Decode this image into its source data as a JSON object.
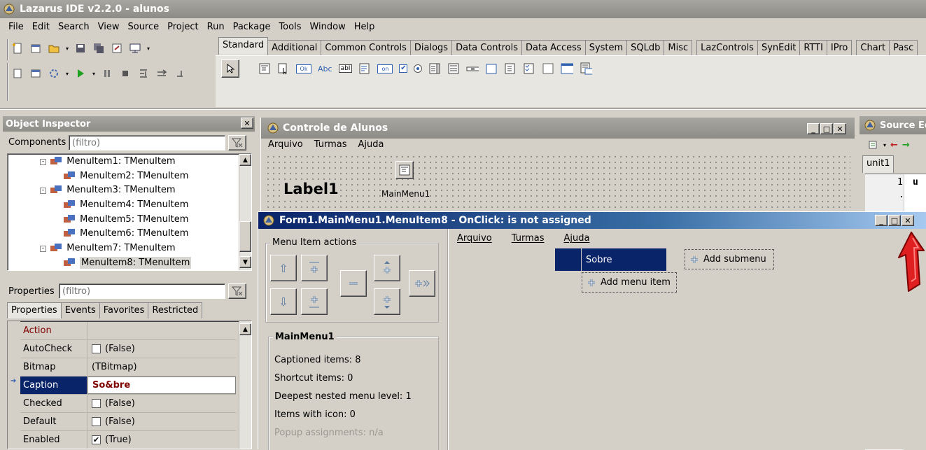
{
  "app": {
    "title": "Lazarus IDE v2.2.0 - alunos",
    "menu": [
      "File",
      "Edit",
      "Search",
      "View",
      "Source",
      "Project",
      "Run",
      "Package",
      "Tools",
      "Window",
      "Help"
    ]
  },
  "palette": {
    "tabs": [
      "Standard",
      "Additional",
      "Common Controls",
      "Dialogs",
      "Data Controls",
      "Data Access",
      "System",
      "SQLdb",
      "Misc",
      "LazControls",
      "SynEdit",
      "RTTI",
      "IPro",
      "Chart",
      "Pasc"
    ],
    "active_tab": "Standard",
    "component_labels": [
      "Ok",
      "Abc",
      "abI",
      "on"
    ]
  },
  "object_inspector": {
    "title": "Object Inspector",
    "components_label": "Components",
    "components_filter_placeholder": "(filtro)",
    "tree": [
      {
        "label": "MenuItem1: TMenuItem",
        "level": 1,
        "expander": "-"
      },
      {
        "label": "MenuItem2: TMenuItem",
        "level": 2
      },
      {
        "label": "MenuItem3: TMenuItem",
        "level": 1,
        "expander": "-"
      },
      {
        "label": "MenuItem4: TMenuItem",
        "level": 2
      },
      {
        "label": "MenuItem5: TMenuItem",
        "level": 2
      },
      {
        "label": "MenuItem6: TMenuItem",
        "level": 2
      },
      {
        "label": "MenuItem7: TMenuItem",
        "level": 1,
        "expander": "-"
      },
      {
        "label": "MenuItem8: TMenuItem",
        "level": 2,
        "selected": true
      }
    ],
    "properties_label": "Properties",
    "properties_filter_placeholder": "(filtro)",
    "tabs": [
      "Properties",
      "Events",
      "Favorites",
      "Restricted"
    ],
    "properties": [
      {
        "name": "Action",
        "value": "",
        "highlight_name": true
      },
      {
        "name": "AutoCheck",
        "value": "(False)",
        "checkbox": true,
        "checked": false
      },
      {
        "name": "Bitmap",
        "value": "(TBitmap)"
      },
      {
        "name": "Caption",
        "value": "So&bre",
        "selected": true
      },
      {
        "name": "Checked",
        "value": "(False)",
        "checkbox": true,
        "checked": false
      },
      {
        "name": "Default",
        "value": "(False)",
        "checkbox": true,
        "checked": false
      },
      {
        "name": "Enabled",
        "value": "(True)",
        "checkbox": true,
        "checked": true
      }
    ]
  },
  "form": {
    "title": "Controle de Alunos",
    "menu": [
      "Arquivo",
      "Turmas",
      "Ajuda"
    ],
    "label1": "Label1",
    "mainmenu_label": "MainMenu1"
  },
  "source_editor": {
    "title": "Source Ed",
    "tab": "unit1",
    "line_number": "1",
    "gutter_dot": ".",
    "code_char": "u"
  },
  "menu_editor": {
    "title": "Form1.MainMenu1.MenuItem8 - OnClick: is not assigned",
    "actions_label": "Menu Item actions",
    "menu_heading": "MainMenu1",
    "stats": [
      {
        "text": "Captioned items: 8",
        "disabled": false
      },
      {
        "text": "Shortcut items: 0",
        "disabled": false
      },
      {
        "text": "Deepest nested menu level: 1",
        "disabled": false
      },
      {
        "text": "Items with icon: 0",
        "disabled": false
      },
      {
        "text": "Popup assignments: n/a",
        "disabled": true
      }
    ],
    "menubar": [
      "Arquivo",
      "Turmas",
      "Ajuda"
    ],
    "selected_item": "Sobre",
    "add_submenu": "Add submenu",
    "add_menu_item": "Add menu item"
  },
  "colors": {
    "selection": "#0a246a",
    "caption_value": "#800000",
    "annotation_arrow": "#e02020"
  }
}
